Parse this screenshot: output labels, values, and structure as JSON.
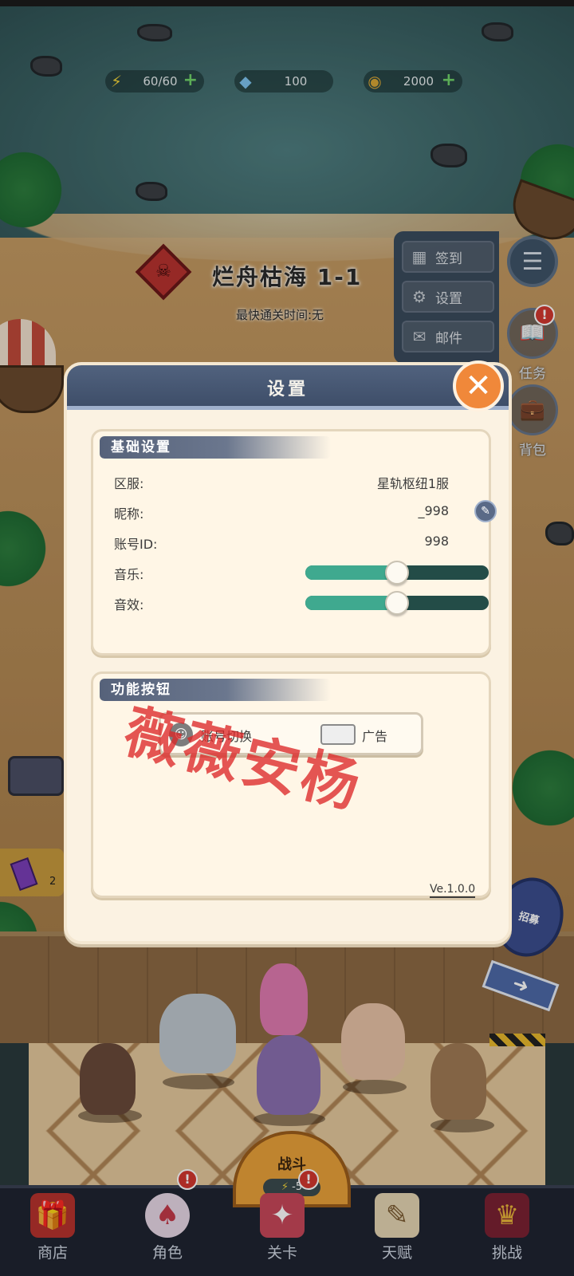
{
  "resources": {
    "energy": {
      "icon": "lightning-icon",
      "value": "60/60"
    },
    "diamonds": {
      "icon": "diamond-icon",
      "value": "100"
    },
    "coins": {
      "icon": "coin-icon",
      "value": "2000"
    }
  },
  "stage": {
    "title": "烂舟枯海 1-1",
    "fastest_time": "最快通关时间:无"
  },
  "side_menu": {
    "items": [
      {
        "label": "签到",
        "icon": "calendar-icon"
      },
      {
        "label": "设置",
        "icon": "gear-icon"
      },
      {
        "label": "邮件",
        "icon": "mail-icon"
      }
    ],
    "tasks_label": "任务",
    "bag_label": "背包",
    "alert": "!"
  },
  "left_items": {
    "crystal_count": "2"
  },
  "recruit_label": "招募",
  "battle": {
    "label": "战斗",
    "cost": "-5"
  },
  "bottom_nav": [
    {
      "label": "商店",
      "icon": "gift-box-icon"
    },
    {
      "label": "角色",
      "icon": "bunny-character-icon"
    },
    {
      "label": "关卡",
      "icon": "gun-icon"
    },
    {
      "label": "天赋",
      "icon": "scroll-icon"
    },
    {
      "label": "挑战",
      "icon": "chest-icon"
    }
  ],
  "settings_dialog": {
    "title": "设置",
    "basic_section": {
      "title": "基础设置",
      "server_label": "区服:",
      "server_value": "星轨枢纽1服",
      "nickname_label": "昵称:",
      "nickname_value": "_998",
      "account_label": "账号ID:",
      "account_value": "998",
      "music_label": "音乐:",
      "music_level": 0.5,
      "sfx_label": "音效:",
      "sfx_level": 0.5
    },
    "function_section": {
      "title": "功能按钮",
      "switch_account_label": "账号切换",
      "ad_label": "广告"
    },
    "version": "Ve.1.0.0"
  },
  "watermark": "薇薇安杨",
  "colors": {
    "dialog_header": "#4a5a76",
    "close_button": "#f0883a",
    "slider_fill": "#3fa98f",
    "slider_track": "#234c47",
    "watermark": "#dc2828"
  }
}
